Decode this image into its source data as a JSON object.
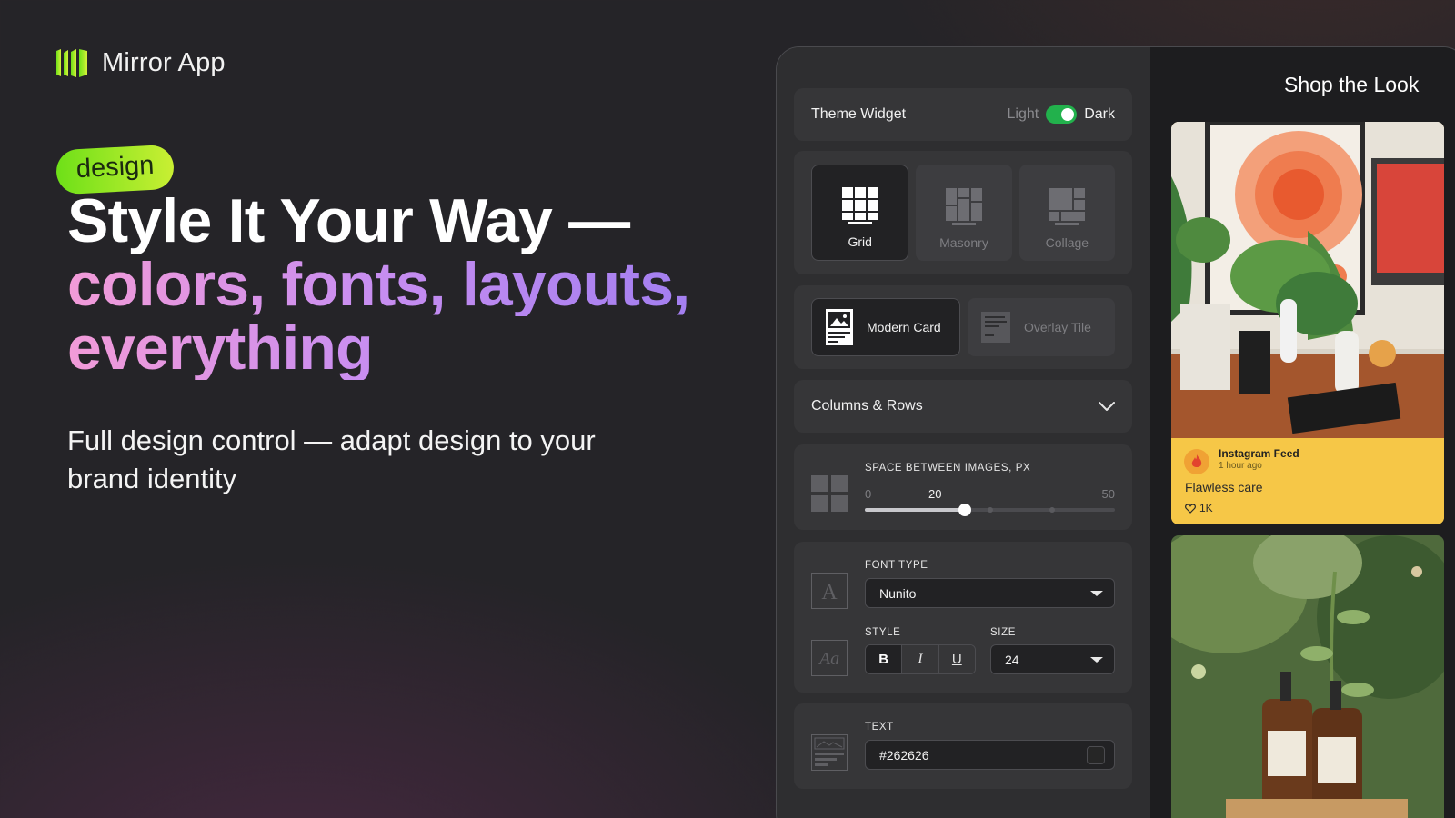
{
  "brand": {
    "name": "Mirror App",
    "accent": "#9be31a"
  },
  "hero": {
    "tag": "design",
    "headline_line1": "Style It Your Way —",
    "headline_line2": "colors, fonts, layouts,",
    "headline_line3": "everything",
    "subhead": "Full design control — adapt design to your brand identity"
  },
  "widget": {
    "theme": {
      "title": "Theme Widget",
      "light_label": "Light",
      "dark_label": "Dark",
      "selected": "Dark"
    },
    "layouts": [
      {
        "label": "Grid",
        "icon": "grid-layout-icon",
        "selected": true
      },
      {
        "label": "Masonry",
        "icon": "masonry-layout-icon",
        "selected": false
      },
      {
        "label": "Collage",
        "icon": "collage-layout-icon",
        "selected": false
      }
    ],
    "card_styles": [
      {
        "label": "Modern Card",
        "icon": "modern-card-icon",
        "selected": true
      },
      {
        "label": "Overlay Tile",
        "icon": "overlay-tile-icon",
        "selected": false
      }
    ],
    "columns_rows": {
      "label": "Columns & Rows",
      "icon": "chevron-down-icon"
    },
    "spacing": {
      "label": "SPACE BETWEEN IMAGES, PX",
      "min": "0",
      "max": "50",
      "value": "20",
      "fraction": 0.4
    },
    "font": {
      "type_label": "FONT TYPE",
      "type_value": "Nunito",
      "style_label": "STYLE",
      "size_label": "SIZE",
      "size_value": "24",
      "style_buttons": [
        {
          "label": "B",
          "active": true
        },
        {
          "label": "I",
          "active": false
        },
        {
          "label": "U",
          "active": false
        }
      ],
      "font_icon_glyph": "A",
      "style_icon_glyph": "Aa"
    },
    "text_color": {
      "label": "TEXT",
      "value": "#262626"
    }
  },
  "preview": {
    "title": "Shop the Look",
    "post": {
      "source": "Instagram Feed",
      "time": "1 hour ago",
      "caption": "Flawless care",
      "likes": "1K",
      "card_color": "#f6c747"
    }
  }
}
